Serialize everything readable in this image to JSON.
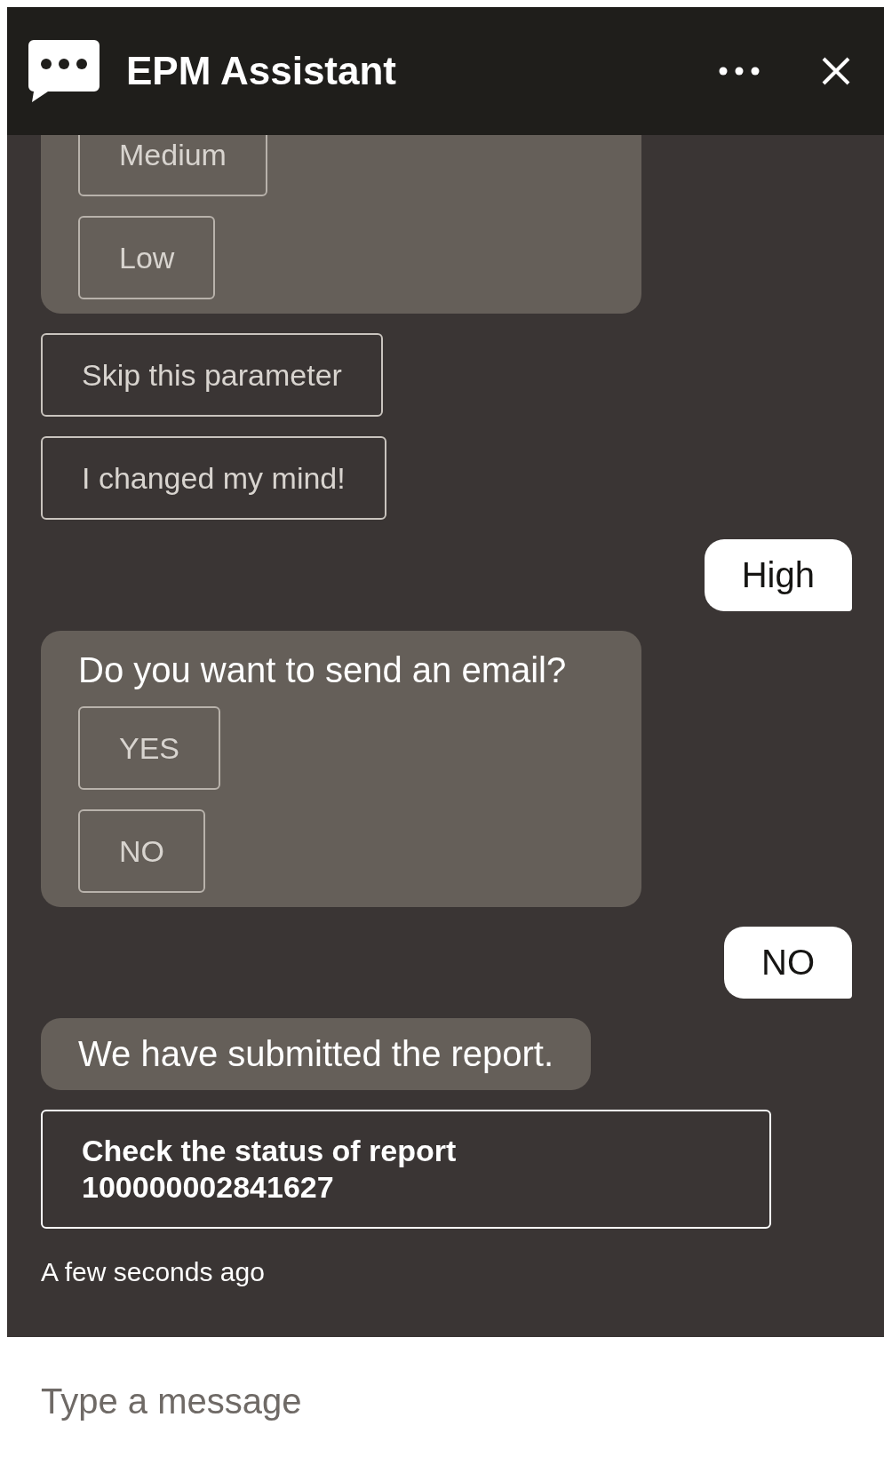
{
  "header": {
    "title": "EPM Assistant"
  },
  "messages": [
    {
      "kind": "choices",
      "options": [
        "Medium",
        "Low"
      ]
    },
    {
      "kind": "action",
      "label": "Skip this parameter"
    },
    {
      "kind": "action",
      "label": "I changed my mind!"
    },
    {
      "kind": "user",
      "text": "High"
    },
    {
      "kind": "choices",
      "text": "Do you want to send an email?",
      "options": [
        "YES",
        "NO"
      ]
    },
    {
      "kind": "user",
      "text": "NO"
    },
    {
      "kind": "bot",
      "text": "We have submitted the report."
    },
    {
      "kind": "card",
      "lines": [
        "Check the status of report",
        "100000002841627"
      ]
    },
    {
      "kind": "timestamp",
      "text": "A few seconds ago"
    }
  ],
  "composer": {
    "placeholder": "Type a message"
  }
}
